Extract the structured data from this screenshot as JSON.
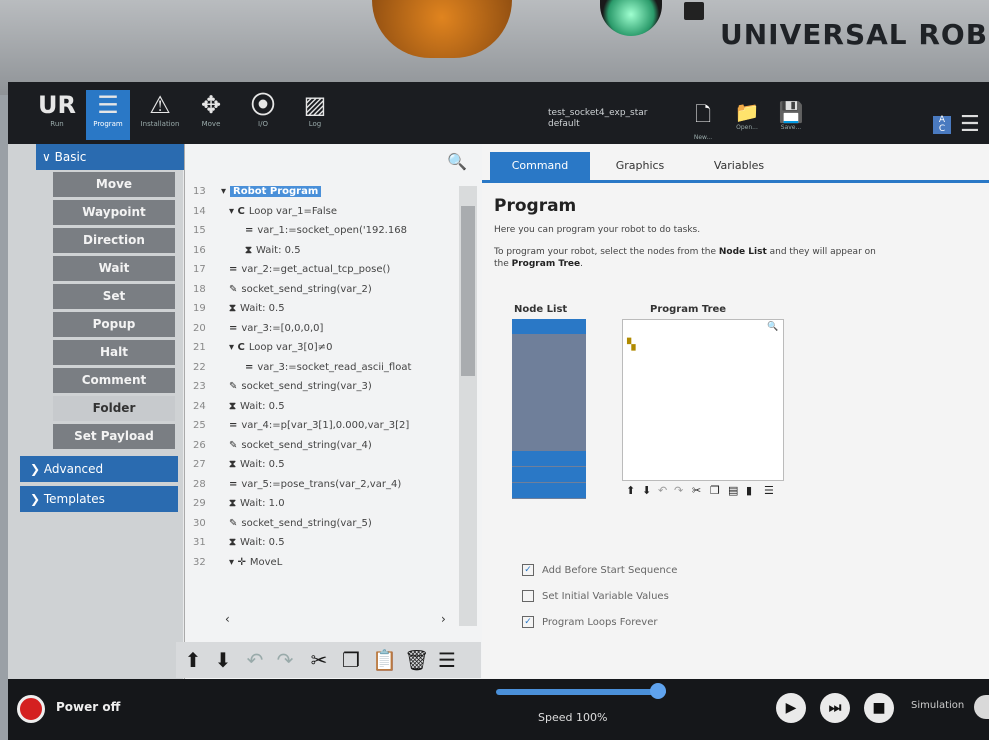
{
  "hardware": {
    "brand": "UNIVERSAL ROBOT"
  },
  "topbar": {
    "tabs": [
      {
        "icon": "UR",
        "label": "Run"
      },
      {
        "icon": "☰",
        "label": "Program"
      },
      {
        "icon": "⚠",
        "label": "Installation"
      },
      {
        "icon": "✥",
        "label": "Move"
      },
      {
        "icon": "⦿",
        "label": "I/O"
      },
      {
        "icon": "▨",
        "label": "Log"
      }
    ],
    "file_name": "test_socket4_exp_star",
    "installation_name": "default",
    "file_buttons": [
      {
        "icon": "🗋",
        "label": "New..."
      },
      {
        "icon": "📁",
        "label": "Open..."
      },
      {
        "icon": "💾",
        "label": "Save..."
      }
    ]
  },
  "sidebar": {
    "basic_header": "Basic",
    "basic_items": [
      "Move",
      "Waypoint",
      "Direction",
      "Wait",
      "Set",
      "Popup",
      "Halt",
      "Comment",
      "Folder",
      "Set Payload"
    ],
    "active_item": "Folder",
    "advanced_header": "Advanced",
    "templates_header": "Templates"
  },
  "program_tree": {
    "lines": [
      {
        "n": "13",
        "indent": 0,
        "icon": "▾",
        "text": "Robot Program"
      },
      {
        "n": "14",
        "indent": 1,
        "icon": "▾ C",
        "text": "Loop var_1=False"
      },
      {
        "n": "15",
        "indent": 3,
        "icon": "=",
        "text": "var_1:=socket_open('192.168"
      },
      {
        "n": "16",
        "indent": 3,
        "icon": "⧗",
        "text": "Wait: 0.5"
      },
      {
        "n": "17",
        "indent": 1,
        "icon": "=",
        "text": "var_2:=get_actual_tcp_pose()"
      },
      {
        "n": "18",
        "indent": 1,
        "icon": "✎",
        "text": "socket_send_string(var_2)"
      },
      {
        "n": "19",
        "indent": 1,
        "icon": "⧗",
        "text": "Wait: 0.5"
      },
      {
        "n": "20",
        "indent": 1,
        "icon": "=",
        "text": "var_3:=[0,0,0,0]"
      },
      {
        "n": "21",
        "indent": 1,
        "icon": "▾ C",
        "text": "Loop var_3[0]≠0"
      },
      {
        "n": "22",
        "indent": 3,
        "icon": "=",
        "text": "var_3:=socket_read_ascii_float"
      },
      {
        "n": "23",
        "indent": 1,
        "icon": "✎",
        "text": "socket_send_string(var_3)"
      },
      {
        "n": "24",
        "indent": 1,
        "icon": "⧗",
        "text": "Wait: 0.5"
      },
      {
        "n": "25",
        "indent": 1,
        "icon": "=",
        "text": "var_4:=p[var_3[1],0.000,var_3[2]"
      },
      {
        "n": "26",
        "indent": 1,
        "icon": "✎",
        "text": "socket_send_string(var_4)"
      },
      {
        "n": "27",
        "indent": 1,
        "icon": "⧗",
        "text": "Wait: 0.5"
      },
      {
        "n": "28",
        "indent": 1,
        "icon": "=",
        "text": "var_5:=pose_trans(var_2,var_4)"
      },
      {
        "n": "29",
        "indent": 1,
        "icon": "⧗",
        "text": "Wait: 1.0"
      },
      {
        "n": "30",
        "indent": 1,
        "icon": "✎",
        "text": "socket_send_string(var_5)"
      },
      {
        "n": "31",
        "indent": 1,
        "icon": "⧗",
        "text": "Wait: 0.5"
      },
      {
        "n": "32",
        "indent": 1,
        "icon": "▾ ✛",
        "text": "MoveL"
      }
    ]
  },
  "tree_toolbar": [
    "⬆",
    "⬇",
    "↶",
    "↷",
    "✂",
    "❐",
    "📋",
    "🗑",
    "☰"
  ],
  "right_panel": {
    "tabs": [
      "Command",
      "Graphics",
      "Variables"
    ],
    "title": "Program",
    "intro": "Here you can program your robot to do tasks.",
    "instruction_pre": "To program your robot, select the nodes from the ",
    "instruction_bold1": "Node List",
    "instruction_mid": " and they will appear on",
    "instruction_line2_pre": "the ",
    "instruction_bold2": "Program Tree",
    "instruction_end": ".",
    "node_list_label": "Node List",
    "program_tree_label": "Program Tree",
    "checkboxes": [
      {
        "label": "Add Before Start Sequence",
        "checked": true
      },
      {
        "label": "Set Initial Variable Values",
        "checked": false
      },
      {
        "label": "Program Loops Forever",
        "checked": true
      }
    ]
  },
  "bottombar": {
    "power_label": "Power off",
    "speed_label": "Speed 100%",
    "speed_value": 100,
    "simulation_label": "Simulation"
  }
}
